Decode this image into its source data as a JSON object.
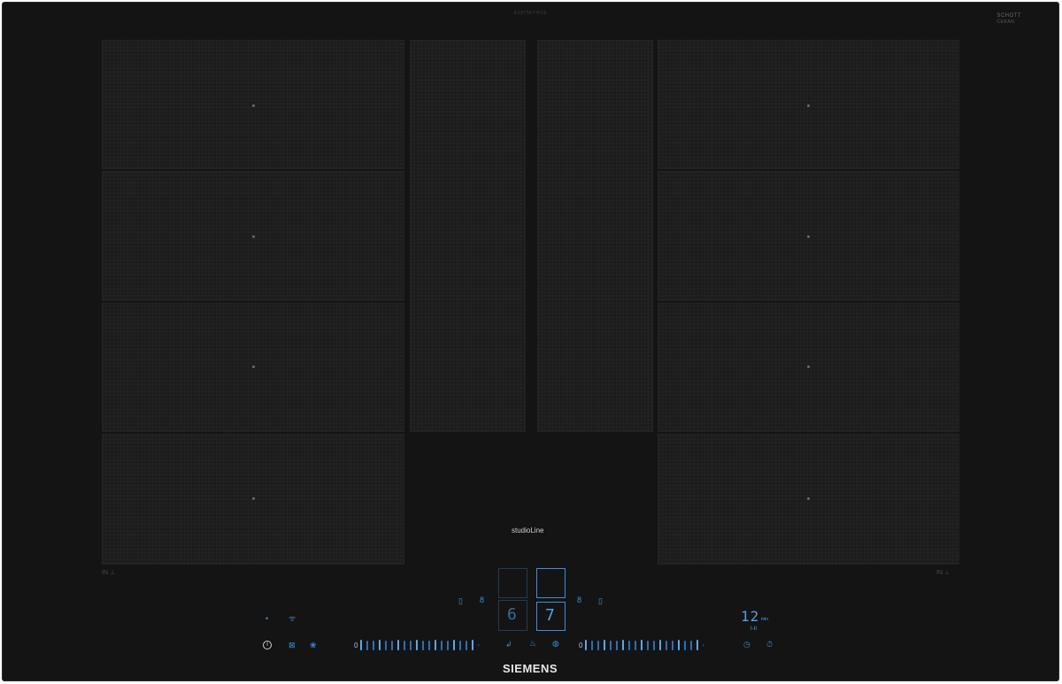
{
  "cooktop": {
    "top_label": "EX875KYW1E",
    "schott_logo": {
      "line1": "SCHOTT",
      "line2": "CERAN",
      "line3": ""
    },
    "product_line": "studioLine",
    "brand": "SIEMENS",
    "flex_left_label": "IN ⊥",
    "flex_right_label": "IN ⊥",
    "accent_color": "#3b8fd6"
  },
  "controls": {
    "left_slider": {
      "zero_label": "0",
      "tick_count": 19
    },
    "right_slider": {
      "zero_label": "0",
      "tick_count": 19
    },
    "display_left_value": "6",
    "display_right_value": "7",
    "timer_value": "12",
    "timer_unit": "min",
    "timer_sub": "I-II"
  }
}
